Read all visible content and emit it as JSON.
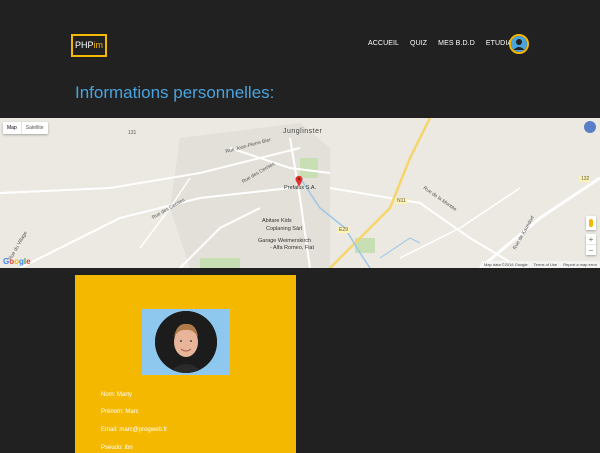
{
  "header": {
    "logo": {
      "part1": "PHP",
      "part2": "im"
    },
    "nav": [
      {
        "label": "ACCUEIL"
      },
      {
        "label": "QUIZ"
      },
      {
        "label": "MES B.D.D"
      },
      {
        "label": "ETUDIANTS"
      }
    ],
    "avatar_icon": "user-avatar-icon"
  },
  "page_title": "Informations personnelles:",
  "map": {
    "type_buttons": {
      "map": "Map",
      "satellite": "Satellite"
    },
    "town": "Junglinster",
    "streets": [
      "Rue des Cerises",
      "Rue des Cerises",
      "Rue Jean-Pierre Bier",
      "Rue du Village",
      "Rue de la Montée",
      "Rue de Kaundorf"
    ],
    "pois": [
      "Prefalux S.A.",
      "Abitare Kids",
      "Coplaning Sàrl",
      "Garage Weimerskirch",
      "- Alfa Romeo, Fiat"
    ],
    "road_numbers": [
      "131",
      "E29",
      "N11",
      "132"
    ],
    "zoom_in": "+",
    "zoom_out": "−",
    "google": "Google",
    "footer": {
      "data": "Map data ©2018 Google",
      "terms": "Terms of Use",
      "report": "Report a map error"
    }
  },
  "profile": {
    "nom": "Nom: Marty",
    "prenom": "Prénom: Marc",
    "email": "Email: marc@progweb.fr",
    "pseudo": "Pseudo: lbn"
  },
  "colors": {
    "background": "#212121",
    "accent": "#f5b800",
    "title": "#4aa3df",
    "photo_bg": "#8ec8ef"
  }
}
